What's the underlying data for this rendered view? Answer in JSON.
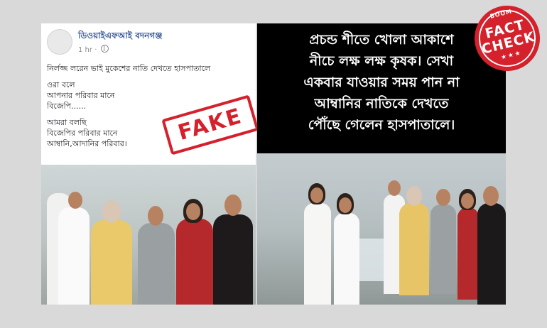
{
  "post": {
    "group_name": "ডিওয়াইএফআই বদনগঞ্জ",
    "time": "1 hr",
    "lines": [
      "নির্লজ্জ লরেন ভাই মুকেশের নাতি দেখতে হাসপাতালে",
      "ওরা বলে",
      "আপনার পরিবার মানে",
      "বিজেপি......",
      "আমরা বলছি",
      "বিজেপির পরিবার মানে",
      "আম্বানি,আদানির পরিবার।"
    ]
  },
  "stamp": {
    "label": "FAKE",
    "color": "#d4212c"
  },
  "card": {
    "lines": [
      "প্রচন্ড শীতে খোলা আকাশে",
      "নীচে লক্ষ লক্ষ কৃষক। সেখা",
      "একবার যাওয়ার সময় পান না",
      "আম্বানির নাতিকে দেখতে",
      "পৌঁছে গেলেন হাসপাতালে।"
    ]
  },
  "badge": {
    "small": "BOOM",
    "top": "FACT",
    "bottom": "CHECK",
    "stars": "★★★",
    "color": "#d4212c"
  }
}
